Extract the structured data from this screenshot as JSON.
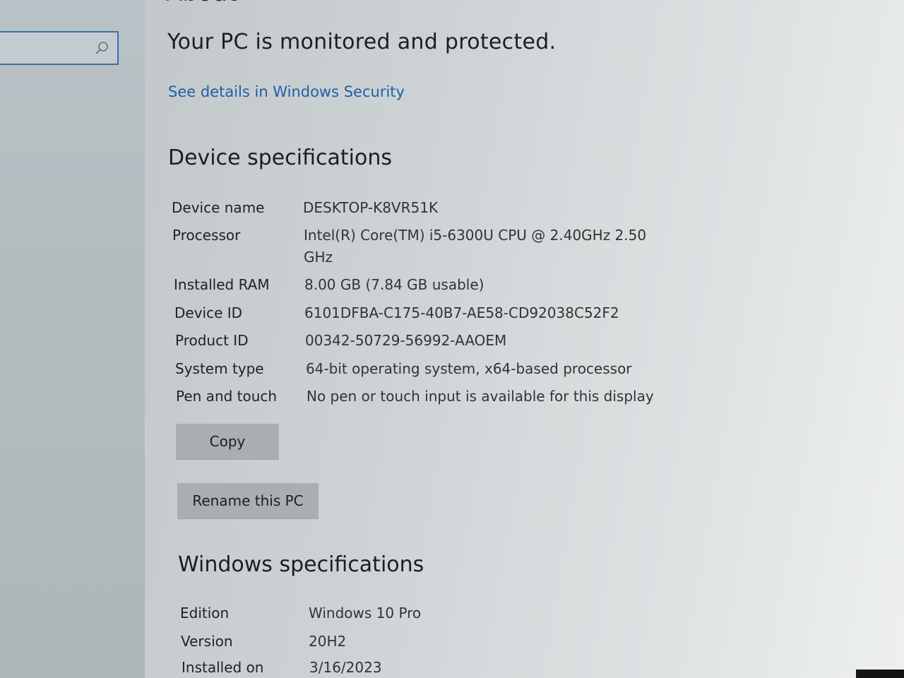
{
  "page": {
    "title": "About",
    "protection_status": "Your PC is monitored and protected.",
    "security_link": "See details in Windows Security"
  },
  "search": {
    "icon": "search-icon"
  },
  "device_specs": {
    "heading": "Device specifications",
    "rows": [
      {
        "label": "Device name",
        "value": "DESKTOP-K8VR51K"
      },
      {
        "label": "Processor",
        "value": "Intel(R) Core(TM) i5-6300U CPU @ 2.40GHz   2.50 GHz"
      },
      {
        "label": "Installed RAM",
        "value": "8.00 GB (7.84 GB usable)"
      },
      {
        "label": "Device ID",
        "value": "6101DFBA-C175-40B7-AE58-CD92038C52F2"
      },
      {
        "label": "Product ID",
        "value": "00342-50729-56992-AAOEM"
      },
      {
        "label": "System type",
        "value": "64-bit operating system, x64-based processor"
      },
      {
        "label": "Pen and touch",
        "value": "No pen or touch input is available for this display"
      }
    ],
    "copy_label": "Copy",
    "rename_label": "Rename this PC"
  },
  "windows_specs": {
    "heading": "Windows specifications",
    "rows": [
      {
        "label": "Edition",
        "value": "Windows 10 Pro"
      },
      {
        "label": "Version",
        "value": "20H2"
      },
      {
        "label": "Installed on",
        "value": "3/16/2023"
      }
    ]
  },
  "colors": {
    "link": "#1f5fa8",
    "focus_border": "#3b6fb0",
    "button": "#a9afb0"
  }
}
